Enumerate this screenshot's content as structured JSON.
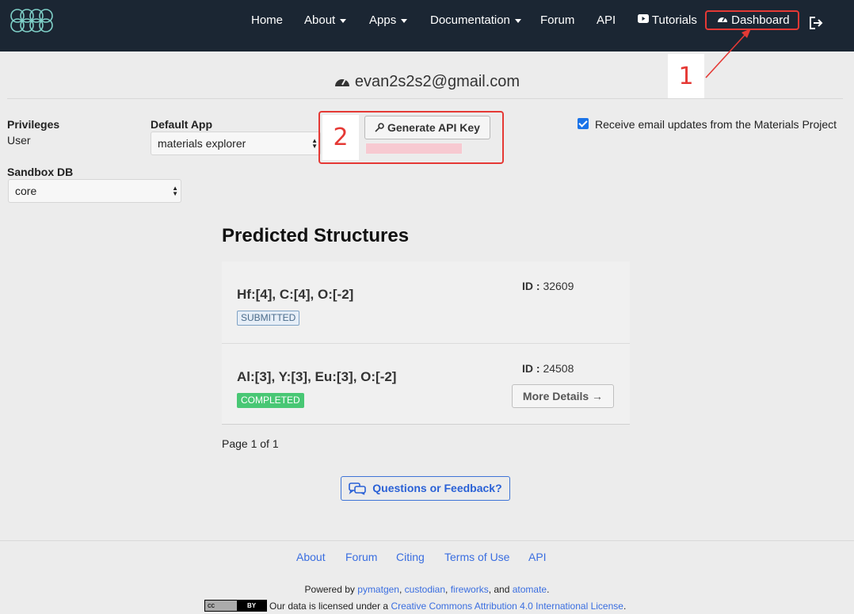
{
  "nav": {
    "items": [
      {
        "label": "Home"
      },
      {
        "label": "About"
      },
      {
        "label": "Apps"
      },
      {
        "label": "Documentation"
      },
      {
        "label": "Forum"
      },
      {
        "label": "API"
      },
      {
        "label": "Tutorials"
      },
      {
        "label": "Dashboard"
      }
    ]
  },
  "annotations": {
    "one": "1",
    "two": "2"
  },
  "header": {
    "email": "evan2s2s2@gmail.com"
  },
  "privileges": {
    "label": "Privileges",
    "value": "User"
  },
  "default_app": {
    "label": "Default App",
    "value": "materials explorer"
  },
  "sandbox": {
    "label": "Sandbox DB",
    "value": "core"
  },
  "api_key": {
    "button_label": "Generate API Key"
  },
  "email_updates": {
    "label": "Receive email updates from the Materials Project",
    "checked": true
  },
  "predicted": {
    "title": "Predicted Structures",
    "items": [
      {
        "formula": "Hf:[4], C:[4], O:[-2]",
        "status": "SUBMITTED",
        "id_label": "ID :",
        "id": "32609"
      },
      {
        "formula": "Al:[3], Y:[3], Eu:[3], O:[-2]",
        "status": "COMPLETED",
        "id_label": "ID :",
        "id": "24508",
        "action": "More Details →"
      }
    ],
    "pager": "Page 1 of 1"
  },
  "feedback": {
    "label": "Questions or Feedback?"
  },
  "footer": {
    "links": [
      "About",
      "Forum",
      "Citing",
      "Terms of Use",
      "API"
    ],
    "powered_prefix": "Powered by",
    "powered_links": [
      "pymatgen",
      "custodian",
      "fireworks",
      "atomate"
    ],
    "powered_and": "and",
    "license_badge_left": "cc",
    "license_badge_right": "BY",
    "license_prefix": "Our data is licensed under a",
    "license_link": "Creative Commons Attribution 4.0 International License"
  },
  "colors": {
    "navbar": "#1b2633",
    "accent": "#e53935",
    "link": "#3a6ee0"
  }
}
